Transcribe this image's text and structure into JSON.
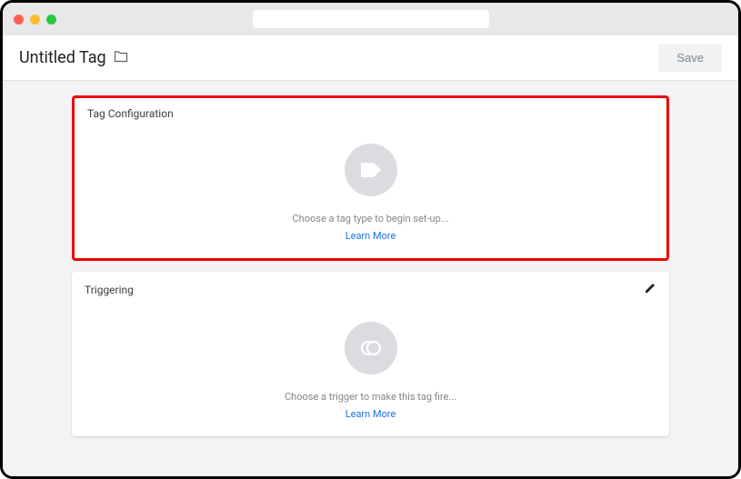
{
  "header": {
    "title": "Untitled Tag",
    "save_label": "Save"
  },
  "cards": {
    "tag_config": {
      "title": "Tag Configuration",
      "prompt": "Choose a tag type to begin set-up...",
      "learn_more": "Learn More"
    },
    "triggering": {
      "title": "Triggering",
      "prompt": "Choose a trigger to make this tag fire...",
      "learn_more": "Learn More"
    }
  }
}
